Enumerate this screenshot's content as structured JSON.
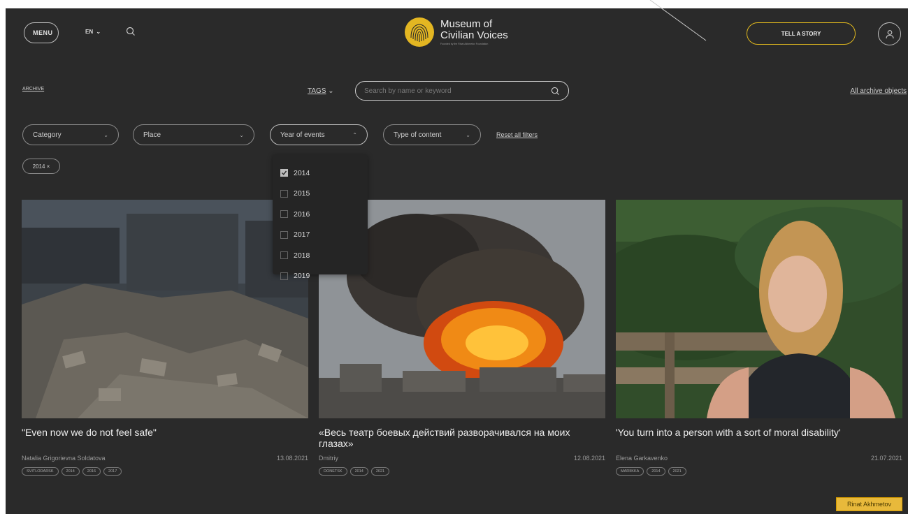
{
  "header": {
    "menu_label": "MENU",
    "lang": "EN",
    "logo_line1": "Museum of",
    "logo_line2": "Civilian Voices",
    "logo_sub": "Founded by the Rinat Akhmetov Foundation",
    "tell_label": "TELL A STORY"
  },
  "archive": {
    "crumb": "ARCHIVE",
    "tags_label": "TAGS",
    "search_placeholder": "Search by name or keyword",
    "all_objects": "All archive objects"
  },
  "filters": {
    "category": "Category",
    "place": "Place",
    "year": "Year of events",
    "type": "Type of content",
    "reset": "Reset all filters",
    "active_chip": "2014 ×"
  },
  "year_options": [
    {
      "label": "2014",
      "checked": true
    },
    {
      "label": "2015",
      "checked": false
    },
    {
      "label": "2016",
      "checked": false
    },
    {
      "label": "2017",
      "checked": false
    },
    {
      "label": "2018",
      "checked": false
    },
    {
      "label": "2019",
      "checked": false
    }
  ],
  "cards": [
    {
      "title": "\"Even now we do not feel safe\"",
      "author": "Natalia Grigorievna Soldatova",
      "date": "13.08.2021",
      "tags": [
        "SVITLODARSK",
        "2014",
        "2016",
        "2017"
      ]
    },
    {
      "title": "«Весь театр боевых действий разворачивался на моих глазах»",
      "author": "Dmitriy",
      "date": "12.08.2021",
      "tags": [
        "DONETSK",
        "2014",
        "2021"
      ]
    },
    {
      "title": "'You turn into a person with a sort of moral disability'",
      "author": "Elena Garkavenko",
      "date": "21.07.2021",
      "tags": [
        "MARIIKKA",
        "2014",
        "2021"
      ]
    }
  ],
  "watermark": "Rinat Akhmetov",
  "colors": {
    "background": "#2a2a2a",
    "accent": "#e0b81e"
  }
}
